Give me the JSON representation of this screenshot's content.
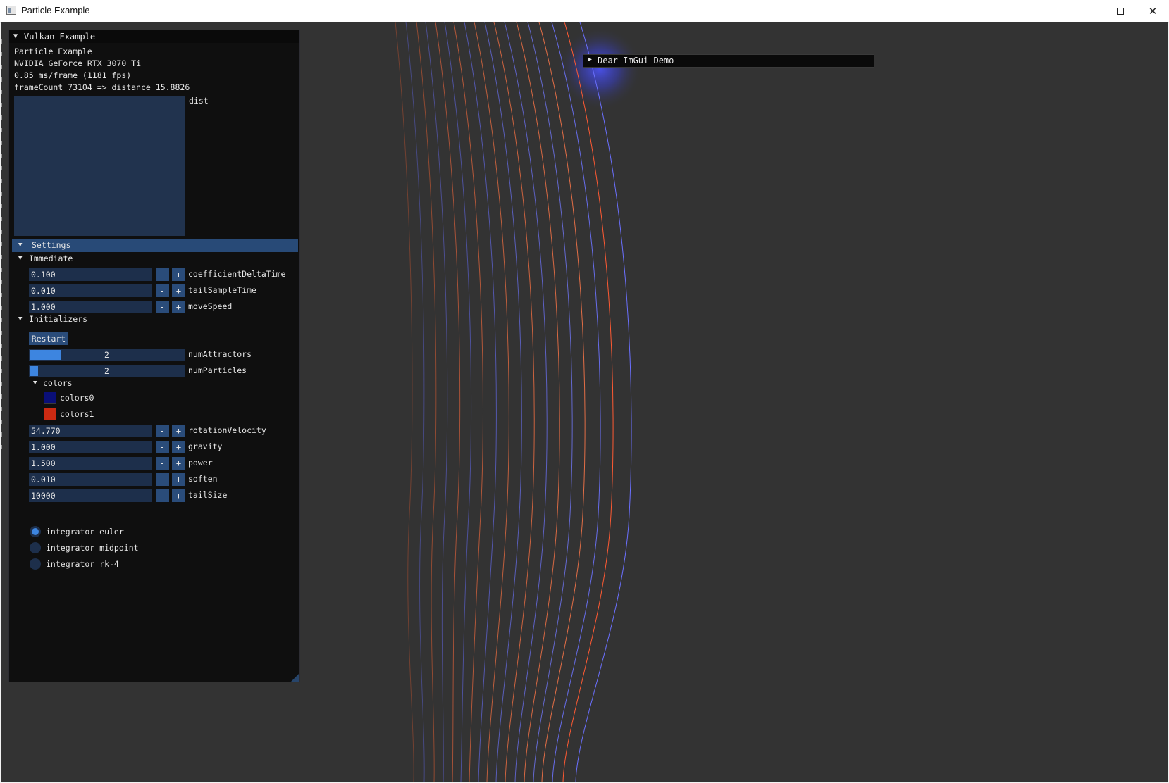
{
  "os_window": {
    "title": "Particle Example",
    "controls": {
      "minimize": "–",
      "maximize": "☐",
      "close": "✕"
    }
  },
  "vulkan_window": {
    "title": "Vulkan Example",
    "app_name": "Particle Example",
    "gpu": "NVIDIA GeForce RTX 3070 Ti",
    "frame_time": "0.85 ms/frame (1181 fps)",
    "frame_info": "frameCount 73104 => distance 15.8826",
    "plot_label": "dist"
  },
  "settings": {
    "header": "Settings",
    "immediate": {
      "label": "Immediate",
      "fields": [
        {
          "value": "0.100",
          "label": "coefficientDeltaTime"
        },
        {
          "value": "0.010",
          "label": "tailSampleTime"
        },
        {
          "value": "1.000",
          "label": "moveSpeed"
        }
      ]
    },
    "initializers": {
      "label": "Initializers",
      "restart_label": "Restart",
      "sliders": [
        {
          "value": "2",
          "label": "numAttractors",
          "fill": 0.2
        },
        {
          "value": "2",
          "label": "numParticles",
          "fill": 0.05
        }
      ],
      "colors": {
        "label": "colors",
        "items": [
          {
            "label": "colors0",
            "color": "#0a0f78"
          },
          {
            "label": "colors1",
            "color": "#cc2a12"
          }
        ]
      },
      "fields": [
        {
          "value": "54.770",
          "label": "rotationVelocity"
        },
        {
          "value": "1.000",
          "label": "gravity"
        },
        {
          "value": "1.500",
          "label": "power"
        },
        {
          "value": "0.010",
          "label": "soften"
        },
        {
          "value": "10000",
          "label": "tailSize"
        }
      ],
      "integrators": [
        {
          "label": "integrator euler",
          "selected": true
        },
        {
          "label": "integrator midpoint",
          "selected": false
        },
        {
          "label": "integrator rk-4",
          "selected": false
        }
      ]
    }
  },
  "demo_window": {
    "title": "Dear ImGui Demo"
  },
  "stepper": {
    "minus": "-",
    "plus": "+"
  },
  "colors": {
    "background": "#333333",
    "panel": "#0f0f0f",
    "frame": "#1d2f4b",
    "accent": "#3d85e0",
    "header": "#284a77"
  }
}
